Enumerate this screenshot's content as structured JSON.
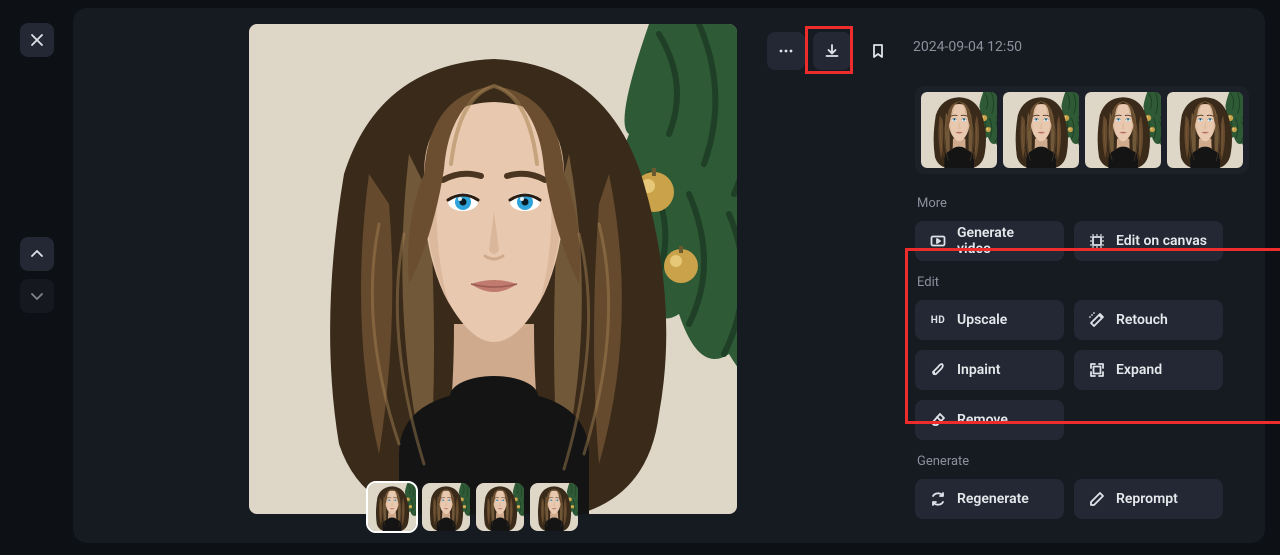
{
  "timestamp": "2024-09-04 12:50",
  "toolbar": {
    "more_icon": "more-horizontal-icon",
    "download_icon": "download-icon",
    "bookmark_icon": "bookmark-icon"
  },
  "viewer": {
    "thumb_count": 4,
    "selected_index": 0
  },
  "generations": {
    "thumb_count": 4
  },
  "sections": {
    "more": {
      "label": "More",
      "generate_video": "Generate video",
      "edit_canvas": "Edit on canvas"
    },
    "edit": {
      "label": "Edit",
      "upscale": "Upscale",
      "retouch": "Retouch",
      "inpaint": "Inpaint",
      "expand": "Expand",
      "remove": "Remove"
    },
    "generate": {
      "label": "Generate",
      "regenerate": "Regenerate",
      "reprompt": "Reprompt"
    }
  },
  "icons": {
    "hd_text": "HD"
  }
}
